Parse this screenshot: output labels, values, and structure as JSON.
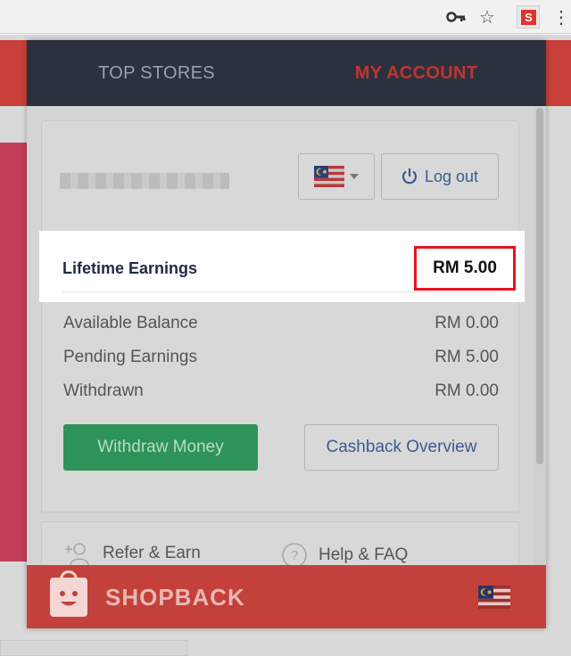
{
  "tabs": {
    "top_stores": "TOP STORES",
    "my_account": "MY ACCOUNT"
  },
  "account": {
    "logout_label": "Log out",
    "lifetime": {
      "label": "Lifetime Earnings",
      "value": "RM 5.00"
    },
    "rows": [
      {
        "label": "Available Balance",
        "value": "RM 0.00"
      },
      {
        "label": "Pending Earnings",
        "value": "RM 5.00"
      },
      {
        "label": "Withdrawn",
        "value": "RM 0.00"
      }
    ],
    "withdraw_label": "Withdraw Money",
    "overview_label": "Cashback Overview"
  },
  "links": {
    "refer": "Refer & Earn",
    "help": "Help & FAQ"
  },
  "footer": {
    "brand": "SHOPBACK"
  },
  "ext": {
    "letter": "S"
  },
  "colors": {
    "accent": "#c0352f",
    "header_bg": "#2c3140",
    "withdraw": "#2e9358",
    "highlight_border": "#e5131b"
  }
}
